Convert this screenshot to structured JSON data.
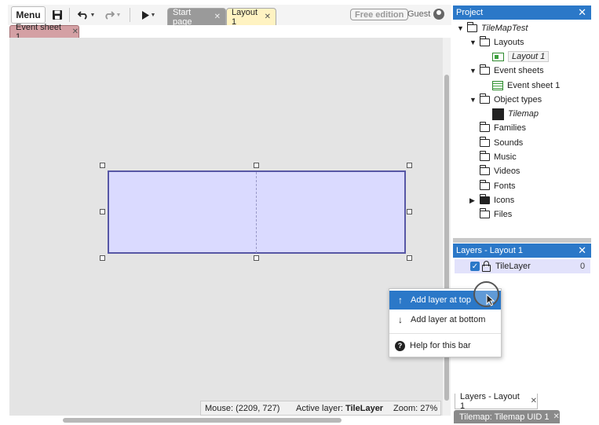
{
  "toolbar": {
    "menu_label": "Menu",
    "icons": [
      "save-icon",
      "undo-icon",
      "redo-icon",
      "play-icon"
    ],
    "tabs": [
      {
        "label": "Start page",
        "active": false
      },
      {
        "label": "Layout 1",
        "active": true
      }
    ],
    "edition_badge": "Free edition",
    "user_label": "Guest"
  },
  "event_tab": {
    "label": "Event sheet 1"
  },
  "statusbar": {
    "mouse_label": "Mouse:",
    "mouse_value": "(2209, 727)",
    "active_layer_label": "Active layer:",
    "active_layer_value": "TileLayer",
    "zoom_label": "Zoom:",
    "zoom_value": "27%"
  },
  "project": {
    "title": "Project",
    "root": "TileMapTest",
    "layouts_folder": "Layouts",
    "layout_item": "Layout 1",
    "event_sheets_folder": "Event sheets",
    "event_sheet_item": "Event sheet 1",
    "object_types_folder": "Object types",
    "object_type_item": "Tilemap",
    "other_folders": [
      "Families",
      "Sounds",
      "Music",
      "Videos",
      "Fonts",
      "Icons",
      "Files"
    ]
  },
  "layers": {
    "title": "Layers - Layout 1",
    "rows": [
      {
        "name": "TileLayer",
        "count": "0",
        "visible": true
      }
    ],
    "bottom_tab": "Layers - Layout 1"
  },
  "bottom_bar": {
    "tilemap_tab": "Tilemap: Tilemap UID 1"
  },
  "context_menu": {
    "items": [
      {
        "label": "Add layer at top",
        "icon": "arrow-up-icon",
        "highlighted": true
      },
      {
        "label": "Add layer at bottom",
        "icon": "arrow-down-icon",
        "highlighted": false
      },
      {
        "label": "Help for this bar",
        "icon": "help-icon",
        "highlighted": false
      }
    ]
  },
  "colors": {
    "accent": "#2b78c8",
    "object_fill": "#dadaff",
    "object_border": "#5757a5",
    "active_tab": "#fff3c2",
    "event_tab": "#d4a0a4"
  }
}
